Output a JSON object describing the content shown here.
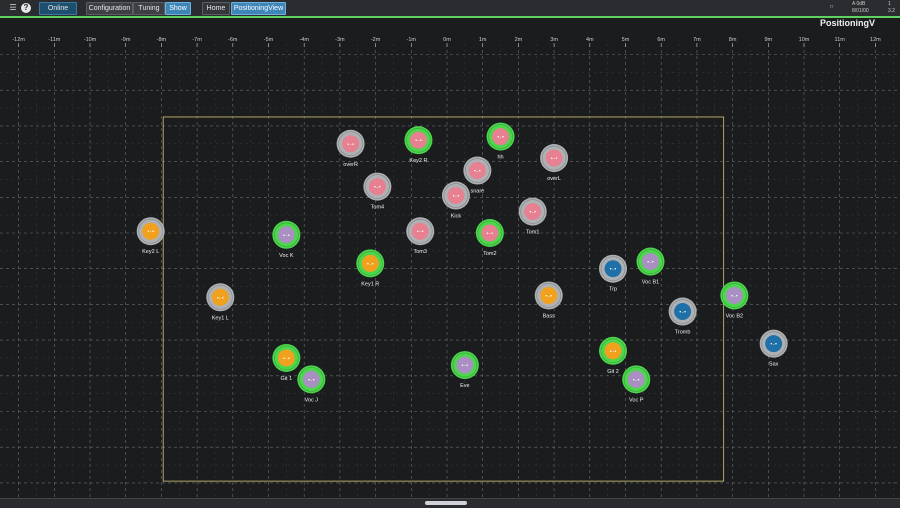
{
  "toolbar": {
    "online_label": "Online",
    "configuration_label": "Configuration",
    "tuning_label": "Tuning",
    "show_label": "Show",
    "home_label": "Home",
    "positioning_label": "PositioningView",
    "status_1": "A 0dB",
    "status_2": "8/01/00",
    "status_3": "1",
    "status_4": "3.2"
  },
  "page_title": "PositioningV",
  "ruler": [
    "-12m",
    "-11m",
    "-10m",
    "-9m",
    "-8m",
    "-7m",
    "-6m",
    "-5m",
    "-4m",
    "-3m",
    "-2m",
    "-1m",
    "0m",
    "1m",
    "2m",
    "3m",
    "4m",
    "5m",
    "6m",
    "7m",
    "8m",
    "9m",
    "10m",
    "11m",
    "12m"
  ],
  "colors": {
    "ring_active": "#4fe04f",
    "ring_inactive": "#b5b9bd",
    "pink": "#e78090",
    "orange": "#f2a11e",
    "purple": "#a98fc2",
    "blue": "#1f6fa8",
    "stage_border": "#d8c77a"
  },
  "sources": [
    {
      "label": "overR",
      "xm": -2.7,
      "ym": 2.5,
      "active": false,
      "color": "pink"
    },
    {
      "label": "Key2 R",
      "xm": -0.8,
      "ym": 2.6,
      "active": true,
      "color": "pink"
    },
    {
      "label": "hh",
      "xm": 1.5,
      "ym": 2.7,
      "active": true,
      "color": "pink"
    },
    {
      "label": "overL",
      "xm": 3.0,
      "ym": 2.1,
      "active": false,
      "color": "pink"
    },
    {
      "label": "snare",
      "xm": 0.85,
      "ym": 1.75,
      "active": false,
      "color": "pink"
    },
    {
      "label": "Tom4",
      "xm": -1.95,
      "ym": 1.3,
      "active": false,
      "color": "pink"
    },
    {
      "label": "Kick",
      "xm": 0.25,
      "ym": 1.05,
      "active": false,
      "color": "pink"
    },
    {
      "label": "Tom1",
      "xm": 2.4,
      "ym": 0.6,
      "active": false,
      "color": "pink"
    },
    {
      "label": "Key2 L",
      "xm": -8.3,
      "ym": 0.05,
      "active": false,
      "color": "orange"
    },
    {
      "label": "Voc K",
      "xm": -4.5,
      "ym": -0.05,
      "active": true,
      "color": "purple"
    },
    {
      "label": "Tom3",
      "xm": -0.75,
      "ym": 0.05,
      "active": false,
      "color": "pink"
    },
    {
      "label": "Tom2",
      "xm": 1.2,
      "ym": 0.0,
      "active": true,
      "color": "pink"
    },
    {
      "label": "Key1 R",
      "xm": -2.15,
      "ym": -0.85,
      "active": true,
      "color": "orange"
    },
    {
      "label": "Trp",
      "xm": 4.65,
      "ym": -1.0,
      "active": false,
      "color": "blue"
    },
    {
      "label": "Voc B1",
      "xm": 5.7,
      "ym": -0.8,
      "active": true,
      "color": "purple"
    },
    {
      "label": "Key1 L",
      "xm": -6.35,
      "ym": -1.8,
      "active": false,
      "color": "orange"
    },
    {
      "label": "Bass",
      "xm": 2.85,
      "ym": -1.75,
      "active": false,
      "color": "orange"
    },
    {
      "label": "Voc B2",
      "xm": 8.05,
      "ym": -1.75,
      "active": true,
      "color": "purple"
    },
    {
      "label": "Tromb",
      "xm": 6.6,
      "ym": -2.2,
      "active": false,
      "color": "blue"
    },
    {
      "label": "Sax",
      "xm": 9.15,
      "ym": -3.1,
      "active": false,
      "color": "blue"
    },
    {
      "label": "Git 1",
      "xm": -4.5,
      "ym": -3.5,
      "active": true,
      "color": "orange"
    },
    {
      "label": "Voc J",
      "xm": -3.8,
      "ym": -4.1,
      "active": true,
      "color": "purple"
    },
    {
      "label": "Eve",
      "xm": 0.5,
      "ym": -3.7,
      "active": true,
      "color": "purple"
    },
    {
      "label": "Git 2",
      "xm": 4.65,
      "ym": -3.3,
      "active": true,
      "color": "orange"
    },
    {
      "label": "Voc P",
      "xm": 5.3,
      "ym": -4.1,
      "active": true,
      "color": "purple"
    }
  ]
}
